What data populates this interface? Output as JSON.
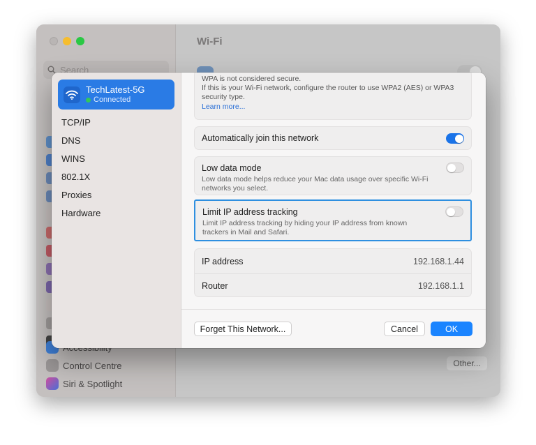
{
  "background": {
    "search_placeholder": "Search",
    "window_title": "Wi-Fi",
    "sidebar_items": [
      {
        "label": "Accessibility",
        "icon": "accessibility-icon"
      },
      {
        "label": "Control Centre",
        "icon": "control-centre-icon"
      },
      {
        "label": "Siri & Spotlight",
        "icon": "siri-icon"
      }
    ],
    "other_button": "Other..."
  },
  "sheet": {
    "network": {
      "name": "TechLatest-5G",
      "status": "Connected",
      "icon": "wifi-icon"
    },
    "sidebar": [
      "TCP/IP",
      "DNS",
      "WINS",
      "802.1X",
      "Proxies",
      "Hardware"
    ],
    "warning": {
      "line1": "WPA is not considered secure.",
      "line2": "If this is your Wi-Fi network, configure the router to use WPA2 (AES) or WPA3",
      "line3": "security type.",
      "link": "Learn more..."
    },
    "auto_join": {
      "label": "Automatically join this network",
      "enabled": true
    },
    "low_data": {
      "label": "Low data mode",
      "desc1": "Low data mode helps reduce your Mac data usage over specific Wi-Fi",
      "desc2": "networks you select.",
      "enabled": false
    },
    "limit_ip": {
      "label": "Limit IP address tracking",
      "desc1": "Limit IP address tracking by hiding your IP address from known",
      "desc2": "trackers in Mail and Safari.",
      "enabled": false
    },
    "ip_address": {
      "label": "IP address",
      "value": "192.168.1.44"
    },
    "router": {
      "label": "Router",
      "value": "192.168.1.1"
    },
    "buttons": {
      "forget": "Forget This Network...",
      "cancel": "Cancel",
      "ok": "OK"
    }
  },
  "colors": {
    "accent": "#1a84ff",
    "highlight": "#2e8fe0",
    "connected": "#34c759"
  }
}
